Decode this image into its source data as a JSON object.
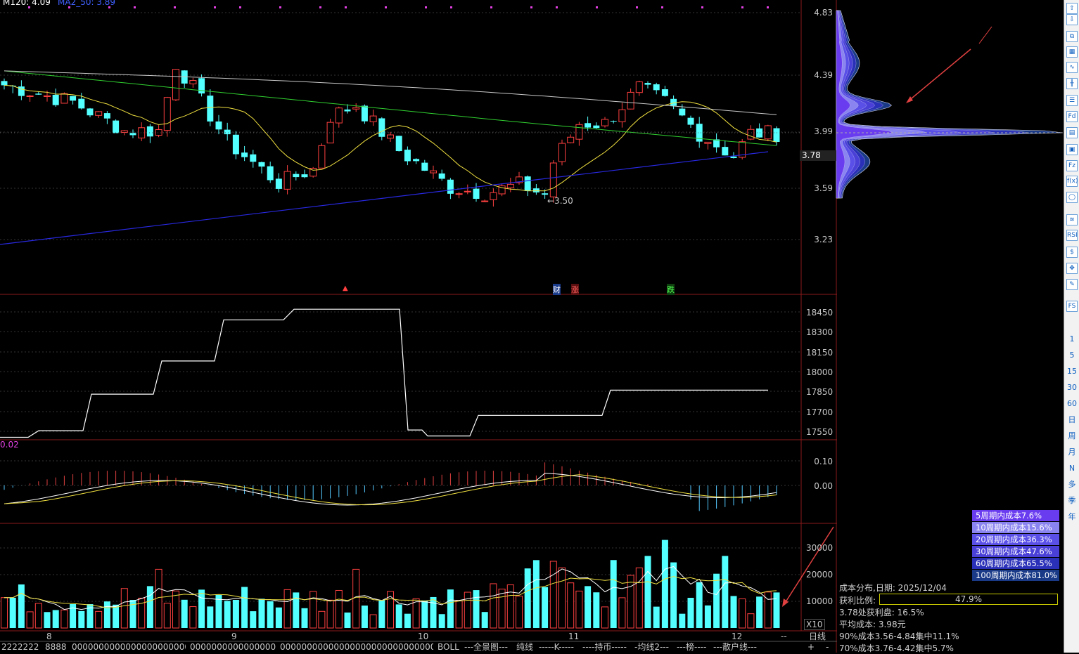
{
  "header": {
    "ma_text": "M120: 4.09",
    "ma2_text": "MA2_50: 3.89"
  },
  "price_axis": [
    "4.83",
    "4.39",
    "3.99",
    "3.59",
    "3.23"
  ],
  "current_price": "3.78",
  "low_marker": "←3.50",
  "event_tags": {
    "cai": "财",
    "zhang": "涨",
    "die": "跌"
  },
  "mid_axis": [
    "18450",
    "18300",
    "18150",
    "18000",
    "17850",
    "17700",
    "17550"
  ],
  "macd_axis": [
    "0.10",
    "0.00"
  ],
  "macd_label": "0.02",
  "vol_axis": [
    "30000",
    "20000",
    "10000"
  ],
  "vol_unit": "X10",
  "months": [
    "8",
    "9",
    "10",
    "11",
    "12"
  ],
  "cost_legend": [
    {
      "label": "5周期内成本7.6%",
      "color": "#6a3cf0"
    },
    {
      "label": "10周期内成本15.6%",
      "color": "#8a84f0"
    },
    {
      "label": "20周期内成本36.3%",
      "color": "#5a50e8"
    },
    {
      "label": "30周期内成本47.6%",
      "color": "#4a40d8"
    },
    {
      "label": "60周期内成本65.5%",
      "color": "#2a30b8"
    },
    {
      "label": "100周期内成本81.0%",
      "color": "#1a3a88"
    }
  ],
  "cost_info": {
    "title": "成本分布,日期: 2025/12/04",
    "profit_label": "获利比例:",
    "profit_value": "47.9%",
    "profit_ratio": 0.479,
    "line2": "3.78处获利盘: 16.5%",
    "line3": "平均成本: 3.98元",
    "line4": "90%成本3.56-4.84集中11.1%",
    "line5": "70%成本3.76-4.42集中5.7%"
  },
  "bottom_tabs": [
    "2222222",
    "8888",
    "000000000000000000000000",
    "0000000000000000003",
    "00000000000000000000000000000000003",
    "BOLL",
    "---全景图---",
    "纯线",
    "-----K-----",
    "----持币-----",
    "-均线2---",
    "---榜----",
    "---散户线---"
  ],
  "period_label": "日线",
  "bottom_controls": {
    "dash": "--",
    "plus": "+",
    "minus": "-"
  },
  "right_toolbar": {
    "icons": [
      "arrow-up-icon",
      "arrow-down-icon",
      "copy-icon",
      "table-icon",
      "line-chart-icon",
      "candlestick-icon",
      "list-icon",
      "fund-icon",
      "grid-icon",
      "book-icon",
      "fzs-icon",
      "fx-icon",
      "circle-icon",
      "wave-icon",
      "rsi-icon",
      "money-icon",
      "move-icon",
      "pen-icon",
      "fs-icon"
    ],
    "labels": {
      "rsi": "RSI",
      "fs": "FS",
      "fzs": "Fz",
      "fx": "f(x)"
    },
    "periods": [
      "1",
      "5",
      "15",
      "30",
      "60",
      "日",
      "周",
      "月",
      "N",
      "多",
      "季",
      "年"
    ]
  }
}
